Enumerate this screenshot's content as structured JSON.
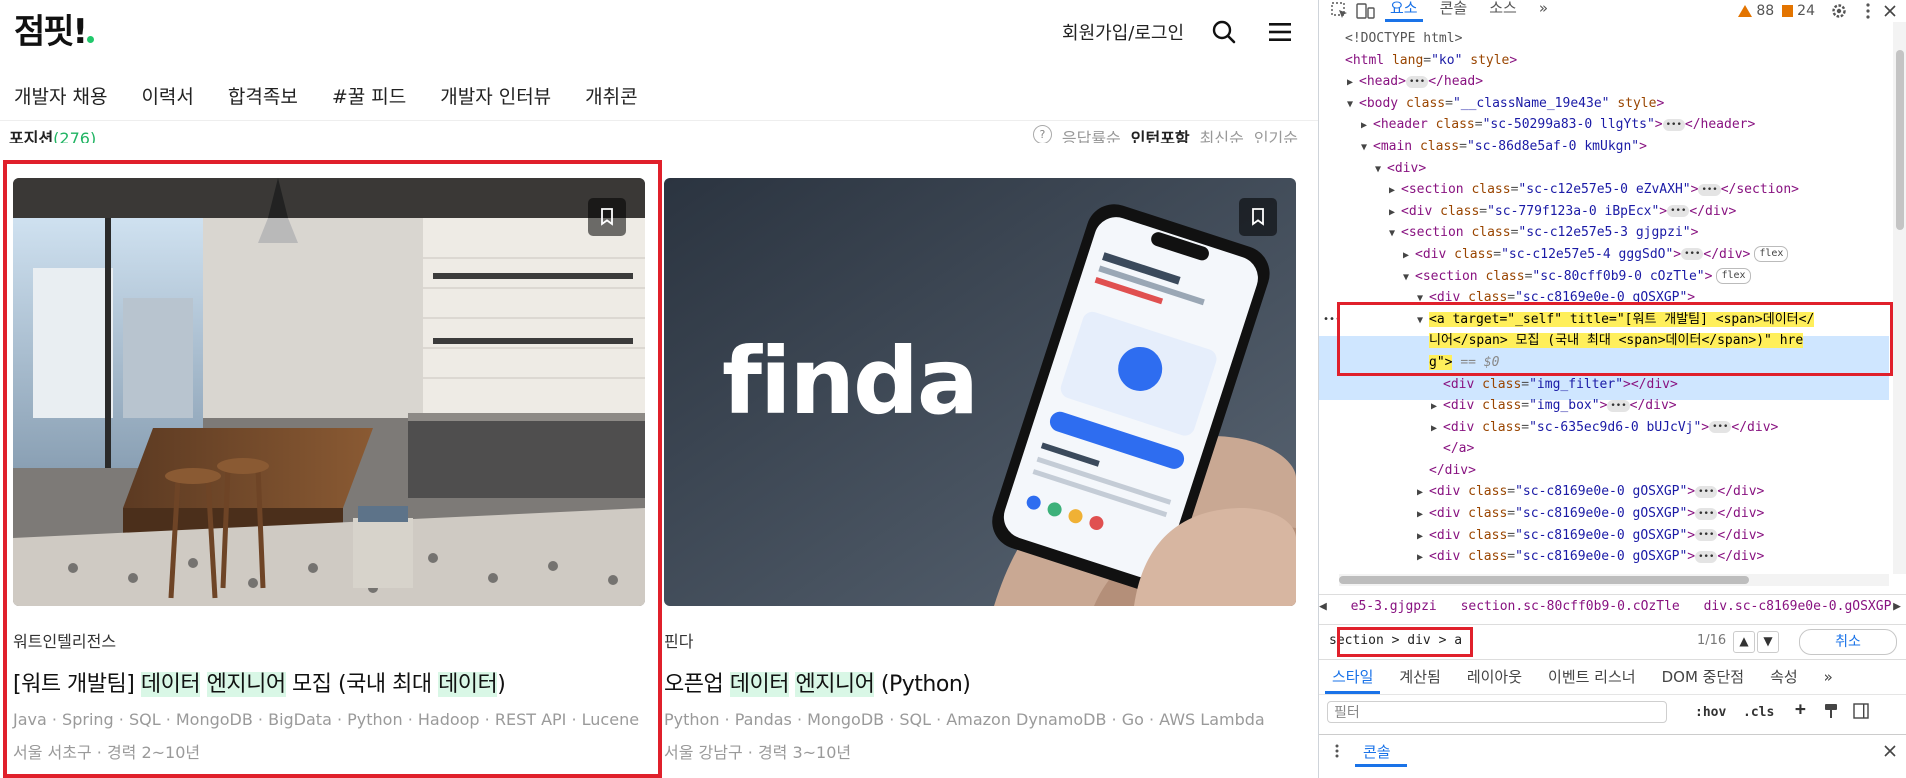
{
  "site": {
    "logo": "점핏!",
    "header": {
      "login": "회원가입/로그인"
    },
    "nav": [
      "개발자 채용",
      "이력서",
      "합격족보",
      "#꿀 피드",
      "개발자 인터뷰",
      "개취콘"
    ],
    "sortbar": {
      "label": "포지션",
      "count": "(276)",
      "sorts": [
        "응답률순",
        "인턴포함",
        "최신순",
        "인기순"
      ]
    },
    "cards": [
      {
        "company": "워트인텔리전스",
        "title_parts": [
          "[워트 개발팀] ",
          "데이터",
          " ",
          "엔지니어",
          " 모집 (국내 최대 ",
          "데이터",
          ")"
        ],
        "tags": "Java · Spring · SQL · MongoDB · BigData · Python · Hadoop · REST API · Lucene",
        "location": "서울 서초구 · 경력 2~10년"
      },
      {
        "company": "핀다",
        "brand": "finda",
        "title_parts": [
          "오픈업 ",
          "데이터",
          " ",
          "엔지니어",
          " (Python)"
        ],
        "tags": "Python · Pandas · MongoDB · SQL · Amazon DynamoDB · Go · AWS Lambda",
        "location": "서울 강남구 · 경력 3~10년"
      }
    ]
  },
  "devtools": {
    "tabs": [
      "요소",
      "콘솔",
      "소스"
    ],
    "active_tab": "요소",
    "warnings": "88",
    "issues": "24",
    "code": [
      {
        "indent": 0,
        "arrow": "",
        "html": "<!DOCTYPE html>"
      },
      {
        "indent": 0,
        "arrow": "",
        "tag": "html",
        "attrs": "lang=\"ko\" style"
      },
      {
        "indent": 1,
        "arrow": "▶",
        "tag": "head",
        "collapsed": true
      },
      {
        "indent": 1,
        "arrow": "▼",
        "tag": "body",
        "attrs": "class=\"__className_19e43e\" style"
      },
      {
        "indent": 2,
        "arrow": "▶",
        "tag": "header",
        "attrs": "class=\"sc-50299a83-0 llgYts\"",
        "collapsed": true
      },
      {
        "indent": 2,
        "arrow": "▼",
        "tag": "main",
        "attrs": "class=\"sc-86d8e5af-0 kmUkgn\""
      },
      {
        "indent": 3,
        "arrow": "▼",
        "tag": "div",
        "attrs": ""
      },
      {
        "indent": 4,
        "arrow": "▶",
        "tag": "section",
        "attrs": "class=\"sc-c12e57e5-0 eZvAXH\"",
        "collapsed": true
      },
      {
        "indent": 4,
        "arrow": "▶",
        "tag": "div",
        "attrs": "class=\"sc-779f123a-0 iBpEcx\"",
        "collapsed": true
      },
      {
        "indent": 4,
        "arrow": "▼",
        "tag": "section",
        "attrs": "class=\"sc-c12e57e5-3 gjgpzi\""
      },
      {
        "indent": 5,
        "arrow": "▶",
        "tag": "div",
        "attrs": "class=\"sc-c12e57e5-4 gggSdO\"",
        "collapsed": true,
        "pill": "flex"
      },
      {
        "indent": 5,
        "arrow": "▼",
        "tag": "section",
        "attrs": "class=\"sc-80cff0b9-0 cOzTle\"",
        "pill": "flex"
      },
      {
        "indent": 6,
        "arrow": "▼",
        "tag": "div",
        "attrs": "class=\"sc-c8169e0e-0 gOSXGP\""
      }
    ],
    "selected_lines": [
      "<a target=\"_self\" title=\"[워트 개발팀] <span>데이터</",
      "니어</span> 모집 (국내 최대 <span>데이터</span>)\" hre",
      "g\"> == $0"
    ],
    "code_after": [
      {
        "indent": 7,
        "arrow": "",
        "tag": "div",
        "attrs": "class=\"img_filter\"",
        "closeSame": true
      },
      {
        "indent": 7,
        "arrow": "▶",
        "tag": "div",
        "attrs": "class=\"img_box\"",
        "collapsed": true
      },
      {
        "indent": 7,
        "arrow": "▶",
        "tag": "div",
        "attrs": "class=\"sc-635ec9d6-0 bUJcVj\"",
        "collapsed": true
      },
      {
        "indent": 7,
        "arrow": "",
        "close": "a"
      },
      {
        "indent": 6,
        "arrow": "",
        "close": "div"
      },
      {
        "indent": 6,
        "arrow": "▶",
        "tag": "div",
        "attrs": "class=\"sc-c8169e0e-0 gOSXGP\"",
        "collapsed": true
      },
      {
        "indent": 6,
        "arrow": "▶",
        "tag": "div",
        "attrs": "class=\"sc-c8169e0e-0 gOSXGP\"",
        "collapsed": true
      },
      {
        "indent": 6,
        "arrow": "▶",
        "tag": "div",
        "attrs": "class=\"sc-c8169e0e-0 gOSXGP\"",
        "collapsed": true
      },
      {
        "indent": 6,
        "arrow": "▶",
        "tag": "div",
        "attrs": "class=\"sc-c8169e0e-0 gOSXGP\"",
        "collapsed": true
      }
    ],
    "breadcrumbs": [
      "e5-3.gjgpzi",
      "section.sc-80cff0b9-0.cOzTle",
      "div.sc-c8169e0e-0.gOSXGP",
      "a"
    ],
    "search": {
      "query": "section > div > a",
      "count": "1/16",
      "cancel": "취소"
    },
    "panel_tabs": [
      "스타일",
      "계산됨",
      "레이아웃",
      "이벤트 리스너",
      "DOM 중단점",
      "속성"
    ],
    "active_panel_tab": "스타일",
    "filter": {
      "placeholder": "필터",
      "hov": ":hov",
      "cls": ".cls"
    },
    "drawer": {
      "title": "콘솔"
    }
  }
}
